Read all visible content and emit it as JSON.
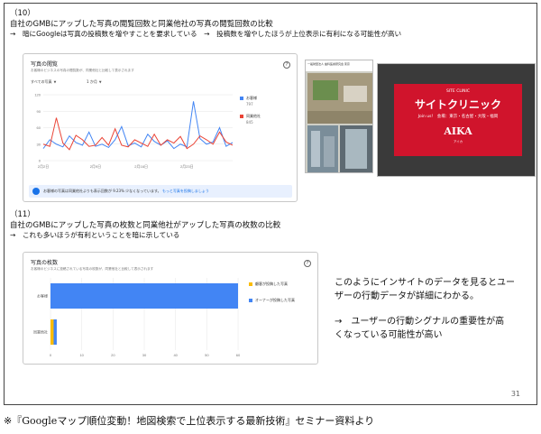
{
  "section1": {
    "number": "（10）",
    "title": "自社のGMBにアップした写真の閲覧回数と同業他社の写真の閲覧回数の比較",
    "subtitle": "→　暗にGoogleは写真の投稿数を増やすことを要求している　→　投稿数を増やしたほうが上位表示に有利になる可能性が高い"
  },
  "views_card": {
    "title": "写真の閲覧",
    "description": "お客様のビジネスの写真の閲覧数が、同業他社と比較して表示されます",
    "filter_type": "すべての写真",
    "filter_period": "1 か月",
    "legend": [
      {
        "label": "お客様",
        "value": "797",
        "color": "#4285f4"
      },
      {
        "label": "同業他社",
        "value": "845",
        "color": "#ea4335"
      }
    ],
    "notice_text": "お客様の写真は同業他社よりも表示回数が 9.23% 少なくなっています。",
    "notice_link": "もっと写真を投稿しましょう"
  },
  "chart_data": [
    {
      "type": "line",
      "title": "写真の閲覧",
      "x": [
        "2月2日",
        "",
        "",
        "",
        "",
        "",
        "",
        "",
        "2月9日",
        "",
        "",
        "",
        "",
        "",
        "",
        "2月16日",
        "",
        "",
        "",
        "",
        "",
        "",
        "2月23日",
        "",
        "",
        "",
        "",
        "",
        "",
        ""
      ],
      "ylim": [
        0,
        120
      ],
      "yticks": [
        0,
        30,
        60,
        90,
        120
      ],
      "xtick_labels": [
        "2月2日",
        "2月9日",
        "2月16日",
        "2月23日"
      ],
      "series": [
        {
          "name": "お客様",
          "color": "#4285f4",
          "values": [
            22,
            38,
            30,
            25,
            45,
            33,
            28,
            52,
            26,
            30,
            24,
            38,
            62,
            27,
            32,
            25,
            48,
            35,
            28,
            36,
            22,
            30,
            25,
            108,
            40,
            30,
            34,
            60,
            26,
            33
          ]
        },
        {
          "name": "同業他社",
          "color": "#ea4335",
          "values": [
            30,
            26,
            78,
            32,
            20,
            46,
            38,
            26,
            28,
            42,
            28,
            58,
            28,
            25,
            38,
            32,
            26,
            48,
            28,
            38,
            32,
            44,
            22,
            30,
            45,
            38,
            30,
            52,
            34,
            28
          ]
        }
      ]
    },
    {
      "type": "bar",
      "title": "写真の枚数",
      "categories": [
        "お客様",
        "同業他社"
      ],
      "series": [
        {
          "name": "顧客が投稿した写真",
          "color": "#fbbc04",
          "values": [
            0,
            1
          ]
        },
        {
          "name": "オーナーが投稿した写真",
          "color": "#4285f4",
          "values": [
            60,
            1
          ]
        }
      ],
      "xlim": [
        0,
        60
      ],
      "xticks": [
        0,
        10,
        20,
        30,
        40,
        50,
        60
      ]
    }
  ],
  "photo_small": {
    "caption": "一般財団法人 歯科医療研究会 東京"
  },
  "photo_tv": {
    "brand": "SITE CLINIC",
    "title": "サイトクリニック",
    "sub": "Join us!　会場：東京・名古屋・大阪・福岡",
    "logo": "AIKA",
    "logo_sub": "アイカ"
  },
  "section2": {
    "number": "（11）",
    "title": "自社のGMBにアップした写真の枚数と同業他社がアップした写真の枚数の比較",
    "subtitle": "→　これも多いほうが有利ということを暗に示している"
  },
  "count_card": {
    "title": "写真の枚数",
    "description": "お客様のビジネスに投稿されている写真の枚数が、同業他社と比較して表示されます"
  },
  "note": {
    "line1": "このようにインサイトのデータを見るとユー",
    "line2": "ザーの行動データが詳細にわかる。",
    "line3": "→　ユーザーの行動シグナルの重要性が高",
    "line4": "くなっている可能性が高い"
  },
  "page_number": "31",
  "footer": "※『Googleマップ順位変動！地図検索で上位表示する最新技術』セミナー資料より"
}
